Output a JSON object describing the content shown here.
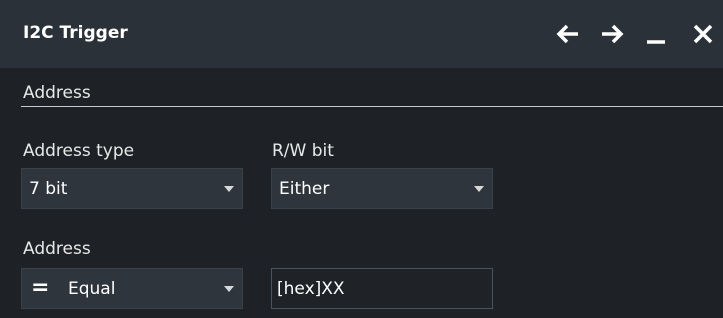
{
  "window": {
    "title": "I2C Trigger",
    "icons": [
      "arrow-left-icon",
      "arrow-right-icon",
      "minimize-icon",
      "close-icon"
    ]
  },
  "section": {
    "label": "Address"
  },
  "address_type": {
    "label": "Address type",
    "value": "7 bit"
  },
  "rw_bit": {
    "label": "R/W bit",
    "value": "Either"
  },
  "address": {
    "label": "Address",
    "condition_symbol": "=",
    "condition_value": "Equal",
    "value": "[hex]XX"
  },
  "colors": {
    "background": "#1e2125",
    "titlebar": "#2a3138",
    "dropdown": "#2f353c",
    "text": "#e8e8e8"
  }
}
